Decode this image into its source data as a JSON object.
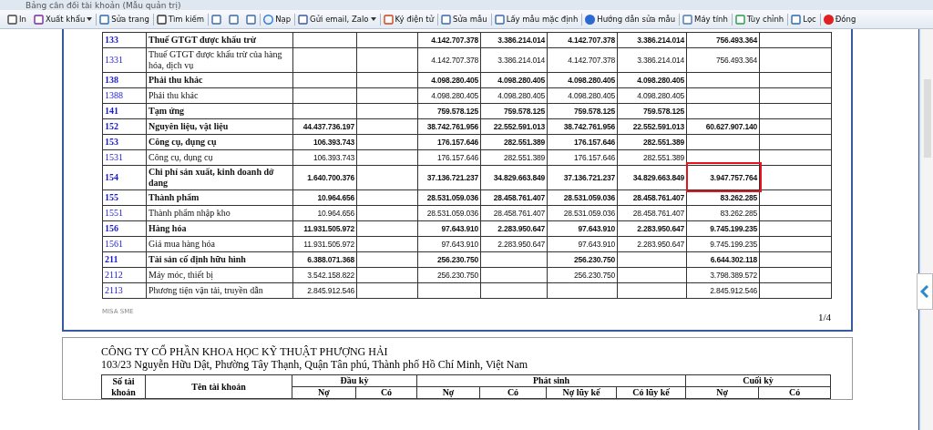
{
  "window": {
    "title": "Bảng cân đối tài khoản (Mẫu quản trị)"
  },
  "toolbar": [
    {
      "label": "In",
      "dropdown": false,
      "separator_after": false
    },
    {
      "label": "Xuất khẩu",
      "dropdown": true,
      "separator_after": true
    },
    {
      "label": "Sửa trang",
      "dropdown": false,
      "separator_after": true
    },
    {
      "label": "Tìm kiếm",
      "dropdown": false,
      "separator_after": true
    },
    {
      "dropdown": false,
      "separator_after": false
    },
    {
      "dropdown": false,
      "separator_after": false
    },
    {
      "dropdown": false,
      "separator_after": true
    },
    {
      "label": "Nạp",
      "dropdown": false,
      "separator_after": true
    },
    {
      "label": "Gửi email, Zalo",
      "dropdown": true,
      "separator_after": true
    },
    {
      "label": "Ký điện tử",
      "dropdown": false,
      "separator_after": true
    },
    {
      "label": "Sửa mẫu",
      "dropdown": false,
      "separator_after": true
    },
    {
      "label": "Lấy mẫu mặc định",
      "dropdown": false,
      "separator_after": true
    },
    {
      "label": "Hướng dẫn sửa mẫu",
      "dropdown": false,
      "separator_after": true
    },
    {
      "label": "Máy tính",
      "dropdown": false,
      "separator_after": true
    },
    {
      "label": "Tùy chỉnh",
      "dropdown": false,
      "separator_after": true
    },
    {
      "label": "Lọc",
      "dropdown": false,
      "separator_after": true
    },
    {
      "label": "Đóng",
      "dropdown": false,
      "separator_after": false
    }
  ],
  "page_1": {
    "rows": [
      {
        "code": "133",
        "name": "Thuế GTGT được khấu trừ",
        "kind": "group",
        "marked": false,
        "values": {
          "period_debit": "4.142.707.378",
          "period_credit": "3.386.214.014",
          "cumulative_debit": "4.142.707.378",
          "cumulative_credit": "3.386.214.014",
          "closing_debit": "756.493.364"
        }
      },
      {
        "code": "1331",
        "name": "Thuế GTGT được khấu trừ của hàng hóa, dịch vụ",
        "kind": "detail",
        "marked": false,
        "values": {
          "period_debit": "4.142.707.378",
          "period_credit": "3.386.214.014",
          "cumulative_debit": "4.142.707.378",
          "cumulative_credit": "3.386.214.014",
          "closing_debit": "756.493.364"
        }
      },
      {
        "code": "138",
        "name": "Phải thu khác",
        "kind": "group",
        "marked": false,
        "values": {
          "period_debit": "4.098.280.405",
          "period_credit": "4.098.280.405",
          "cumulative_debit": "4.098.280.405",
          "cumulative_credit": "4.098.280.405"
        }
      },
      {
        "code": "1388",
        "name": "Phải thu khác",
        "kind": "detail",
        "marked": false,
        "values": {
          "period_debit": "4.098.280.405",
          "period_credit": "4.098.280.405",
          "cumulative_debit": "4.098.280.405",
          "cumulative_credit": "4.098.280.405"
        }
      },
      {
        "code": "141",
        "name": "Tạm ứng",
        "kind": "group",
        "marked": false,
        "values": {
          "period_debit": "759.578.125",
          "period_credit": "759.578.125",
          "cumulative_debit": "759.578.125",
          "cumulative_credit": "759.578.125"
        }
      },
      {
        "code": "152",
        "name": "Nguyên liệu, vật liệu",
        "kind": "group",
        "marked": false,
        "values": {
          "opening_debit": "44.437.736.197",
          "period_debit": "38.742.761.956",
          "period_credit": "22.552.591.013",
          "cumulative_debit": "38.742.761.956",
          "cumulative_credit": "22.552.591.013",
          "closing_debit": "60.627.907.140"
        }
      },
      {
        "code": "153",
        "name": "Công cụ, dụng cụ",
        "kind": "group",
        "marked": false,
        "values": {
          "opening_debit": "106.393.743",
          "period_debit": "176.157.646",
          "period_credit": "282.551.389",
          "cumulative_debit": "176.157.646",
          "cumulative_credit": "282.551.389"
        }
      },
      {
        "code": "1531",
        "name": "Công cụ, dụng cụ",
        "kind": "detail",
        "marked": false,
        "values": {
          "opening_debit": "106.393.743",
          "period_debit": "176.157.646",
          "period_credit": "282.551.389",
          "cumulative_debit": "176.157.646",
          "cumulative_credit": "282.551.389"
        }
      },
      {
        "code": "154",
        "name": "Chi phí sản xuất, kinh doanh dở dang",
        "kind": "group",
        "marked": true,
        "values": {
          "opening_debit": "1.640.700.376",
          "period_debit": "37.136.721.237",
          "period_credit": "34.829.663.849",
          "cumulative_debit": "37.136.721.237",
          "cumulative_credit": "34.829.663.849",
          "closing_debit": "3.947.757.764"
        }
      },
      {
        "code": "155",
        "name": "Thành phẩm",
        "kind": "group",
        "marked": false,
        "values": {
          "opening_debit": "10.964.656",
          "period_debit": "28.531.059.036",
          "period_credit": "28.458.761.407",
          "cumulative_debit": "28.531.059.036",
          "cumulative_credit": "28.458.761.407",
          "closing_debit": "83.262.285"
        }
      },
      {
        "code": "1551",
        "name": "Thành phẩm nhập kho",
        "kind": "detail",
        "marked": false,
        "values": {
          "opening_debit": "10.964.656",
          "period_debit": "28.531.059.036",
          "period_credit": "28.458.761.407",
          "cumulative_debit": "28.531.059.036",
          "cumulative_credit": "28.458.761.407",
          "closing_debit": "83.262.285"
        }
      },
      {
        "code": "156",
        "name": "Hàng hóa",
        "kind": "group",
        "marked": false,
        "values": {
          "opening_debit": "11.931.505.972",
          "period_debit": "97.643.910",
          "period_credit": "2.283.950.647",
          "cumulative_debit": "97.643.910",
          "cumulative_credit": "2.283.950.647",
          "closing_debit": "9.745.199.235"
        }
      },
      {
        "code": "1561",
        "name": "Giá mua hàng hóa",
        "kind": "detail",
        "marked": false,
        "values": {
          "opening_debit": "11.931.505.972",
          "period_debit": "97.643.910",
          "period_credit": "2.283.950.647",
          "cumulative_debit": "97.643.910",
          "cumulative_credit": "2.283.950.647",
          "closing_debit": "9.745.199.235"
        }
      },
      {
        "code": "211",
        "name": "Tài sản cố định hữu hình",
        "kind": "group",
        "marked": false,
        "values": {
          "opening_debit": "6.388.071.368",
          "period_debit": "256.230.750",
          "cumulative_debit": "256.230.750",
          "closing_debit": "6.644.302.118"
        }
      },
      {
        "code": "2112",
        "name": "Máy móc, thiết bị",
        "kind": "detail",
        "marked": false,
        "values": {
          "opening_debit": "3.542.158.822",
          "period_debit": "256.230.750",
          "cumulative_debit": "256.230.750",
          "closing_debit": "3.798.389.572"
        }
      },
      {
        "code": "2113",
        "name": "Phương tiện vận tải, truyền dẫn",
        "kind": "detail",
        "marked": false,
        "values": {
          "opening_debit": "2.845.912.546",
          "closing_debit": "2.845.912.546"
        }
      }
    ],
    "footer_brand": "MISA SME",
    "page_number": "1/4"
  },
  "page_2": {
    "company": "CÔNG TY CỔ PHẦN KHOA HỌC KỸ THUẬT PHƯỢNG HẢI",
    "address": "103/23 Nguyễn Hữu Dật, Phường Tây Thạnh, Quận Tân phú, Thành phố Hồ Chí Minh, Việt Nam",
    "header": {
      "code": "Số tài khoản",
      "name": "Tên tài khoản",
      "groups": [
        {
          "label": "Đầu kỳ",
          "columns": [
            "Nợ",
            "Có"
          ]
        },
        {
          "label": "Phát sinh",
          "columns": [
            "Nợ",
            "Có",
            "Nợ lũy kế",
            "Có lũy kế"
          ]
        },
        {
          "label": "Cuối kỳ",
          "columns": [
            "Nợ",
            "Có"
          ]
        }
      ]
    }
  }
}
